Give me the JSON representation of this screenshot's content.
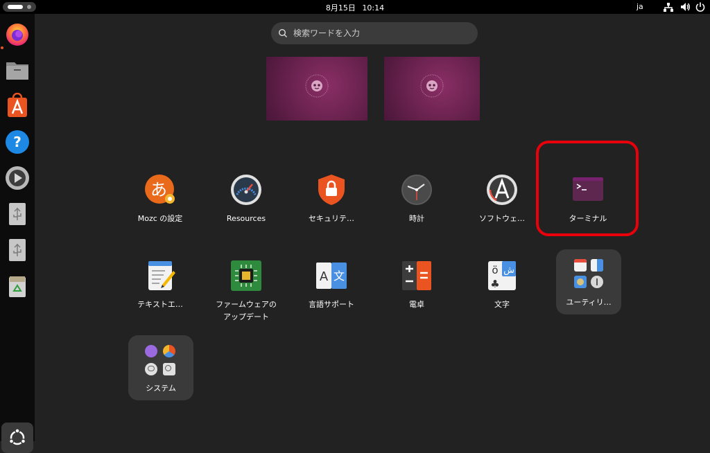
{
  "topbar": {
    "date": "8月15日",
    "time": "10:14",
    "input_language": "ja",
    "icons": [
      "network-icon",
      "volume-icon",
      "power-icon"
    ]
  },
  "dock": {
    "items": [
      {
        "name": "firefox-icon",
        "running": true
      },
      {
        "name": "files-icon",
        "running": false
      },
      {
        "name": "app-center-icon",
        "running": false
      },
      {
        "name": "help-icon",
        "running": false
      },
      {
        "name": "rhythmbox-icon",
        "running": false
      },
      {
        "name": "usb-drive-icon",
        "running": false
      },
      {
        "name": "usb-drive-icon",
        "running": false
      },
      {
        "name": "trash-icon",
        "running": false
      }
    ],
    "show_apps_icon": "ubuntu-logo-icon"
  },
  "search": {
    "placeholder": "検索ワードを入力",
    "value": ""
  },
  "workspaces": {
    "count": 2
  },
  "apps": {
    "mozc": "Mozc の設定",
    "resources": "Resources",
    "security": "セキュリテ…",
    "clock": "時計",
    "software": "ソフトウェ…",
    "terminal": "ターミナル",
    "text_editor": "テキストエ…",
    "firmware": "ファームウェアのアップデート",
    "language": "言語サポート",
    "calculator": "電卓",
    "characters": "文字"
  },
  "folders": {
    "utilities": "ユーティリ…",
    "system": "システム"
  },
  "highlight": {
    "target": "ターミナル",
    "color": "#e8000b"
  },
  "colors": {
    "accent": "#e95420",
    "background": "#222222",
    "wallpaper": "#6e2452"
  }
}
